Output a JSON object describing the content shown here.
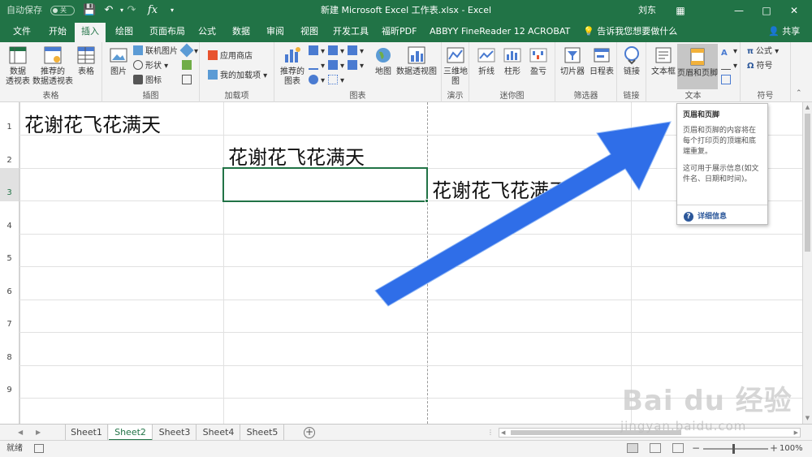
{
  "titlebar": {
    "autosave_label": "自动保存",
    "autosave_state": "关",
    "file_title": "新建 Microsoft Excel 工作表.xlsx  -  Excel",
    "user_name": "刘东"
  },
  "tabs": [
    {
      "label": "文件"
    },
    {
      "label": "开始"
    },
    {
      "label": "插入"
    },
    {
      "label": "绘图"
    },
    {
      "label": "页面布局"
    },
    {
      "label": "公式"
    },
    {
      "label": "数据"
    },
    {
      "label": "审阅"
    },
    {
      "label": "视图"
    },
    {
      "label": "开发工具"
    },
    {
      "label": "福昕PDF"
    },
    {
      "label": "ABBYY FineReader 12"
    },
    {
      "label": "ACROBAT"
    },
    {
      "label": "告诉我您想要做什么"
    }
  ],
  "share_label": "共享",
  "ribbon": {
    "groups": {
      "tables": "表格",
      "illustrations": "插图",
      "addins": "加载项",
      "charts": "图表",
      "tours": "演示",
      "sparklines": "迷你图",
      "filters": "筛选器",
      "links": "链接",
      "text": "文本",
      "symbols": "符号"
    },
    "buttons": {
      "pivot_table": "数据\n透视表",
      "recommended_pivot": "推荐的\n数据透视表",
      "table": "表格",
      "picture": "图片",
      "online_picture": "联机图片",
      "shapes": "形状",
      "icons": "图标",
      "store": "应用商店",
      "my_addins": "我的加载项",
      "recommended_charts": "推荐的\n图表",
      "map": "地图",
      "pivot_chart": "数据透视图",
      "map3d": "三维地\n图",
      "line": "折线",
      "column": "柱形",
      "winloss": "盈亏",
      "slicer": "切片器",
      "timeline": "日程表",
      "link": "链接",
      "textbox": "文本框",
      "header_footer": "页眉和页脚",
      "equation": "公式",
      "symbol": "符号"
    }
  },
  "grid": {
    "row_numbers": [
      "1",
      "2",
      "3",
      "4",
      "5",
      "6",
      "7",
      "8",
      "9"
    ],
    "cells": [
      {
        "text": "花谢花飞花满天"
      },
      {
        "text": "花谢花飞花满天"
      },
      {
        "text": "花谢花飞花满天"
      }
    ]
  },
  "tooltip": {
    "title": "页眉和页脚",
    "desc1": "页眉和页脚的内容将在每个打印页的顶端和底端重复。",
    "desc2": "这可用于展示信息(如文件名、日期和时间)。",
    "link": "详细信息"
  },
  "sheets": [
    {
      "name": "Sheet1",
      "active": false
    },
    {
      "name": "Sheet2",
      "active": true
    },
    {
      "name": "Sheet3",
      "active": false
    },
    {
      "name": "Sheet4",
      "active": false
    },
    {
      "name": "Sheet5",
      "active": false
    }
  ],
  "status": {
    "ready": "就绪",
    "zoom": "100%"
  },
  "watermark": {
    "main": "Bai du 经验",
    "sub": "jingyan.baidu.com"
  },
  "colors": {
    "excel_green": "#217346",
    "arrow_blue": "#2f6ee8",
    "link_blue": "#2b579a"
  }
}
